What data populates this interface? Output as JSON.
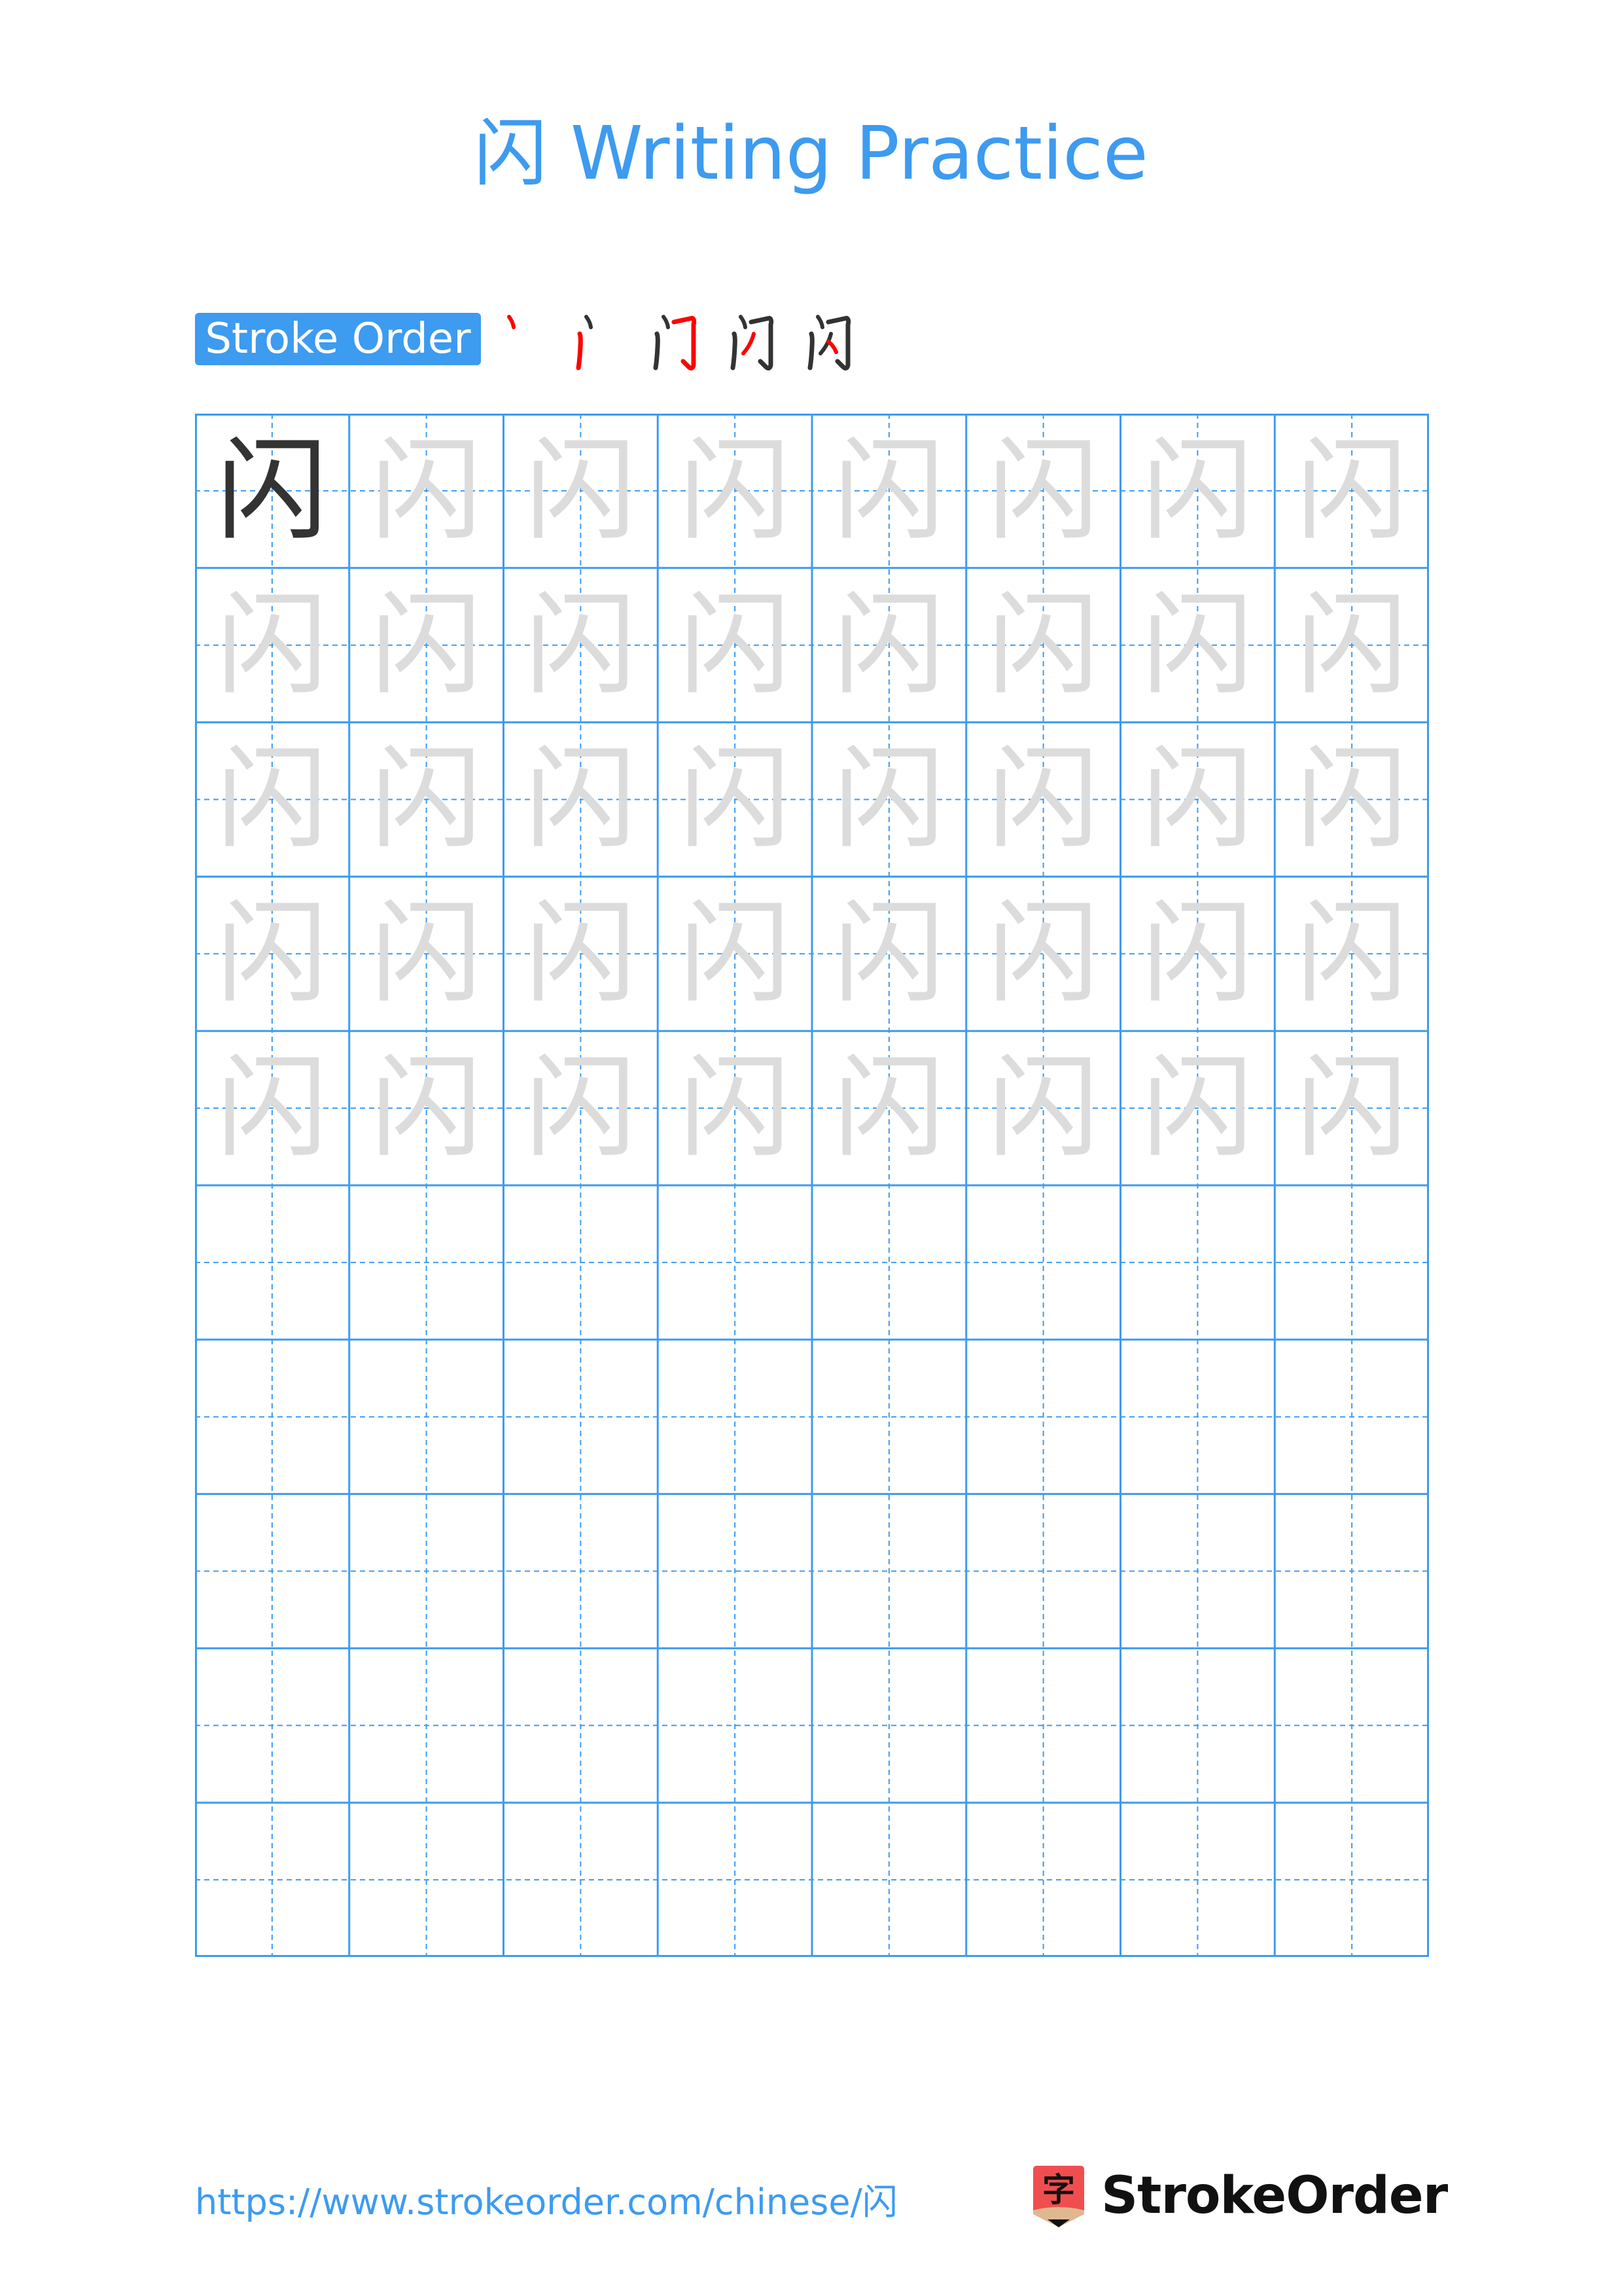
{
  "page": {
    "title": "闪 Writing Practice",
    "character": "闪"
  },
  "stroke_order": {
    "label": "Stroke Order",
    "steps": [
      {
        "step": 1,
        "description": "dot (red)"
      },
      {
        "step": 2,
        "description": "vertical left (red)"
      },
      {
        "step": 3,
        "description": "horizontal-turn-hook (red)"
      },
      {
        "step": 4,
        "description": "left-falling inside (red)"
      },
      {
        "step": 5,
        "description": "right-falling dot inside (red)"
      }
    ],
    "highlight_color": "#ff0000",
    "base_color": "#333333"
  },
  "grid": {
    "columns": 8,
    "rows": 10,
    "traced_rows": 5,
    "model_char_color": "#333333",
    "trace_char_color": "#dcdcdc",
    "line_color": "#3d9bf0"
  },
  "footer": {
    "url": "https://www.strokeorder.com/chinese/闪",
    "brand_name": "StrokeOrder",
    "logo_glyph": "字"
  },
  "colors": {
    "accent": "#3d9bf0",
    "logo_red": "#f04e4e",
    "logo_tan": "#e0b890"
  }
}
